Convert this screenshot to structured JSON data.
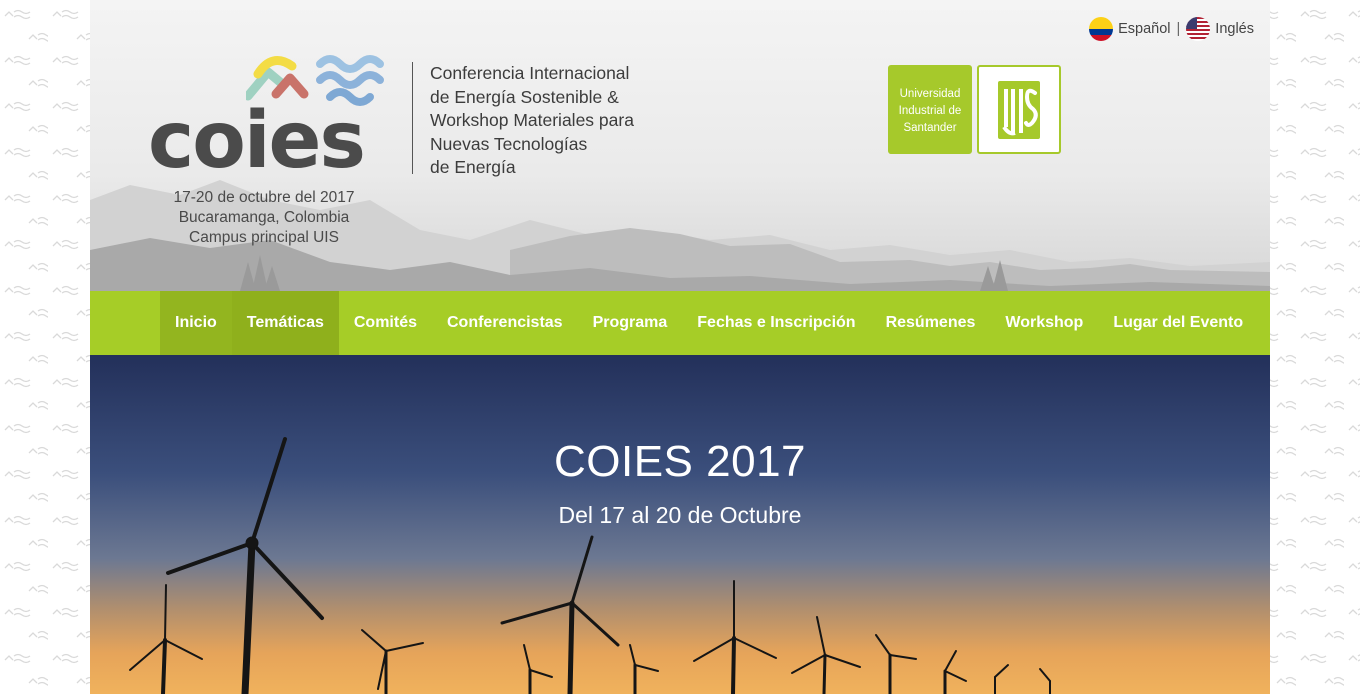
{
  "header": {
    "logo_text": "coies",
    "logo_lines": [
      "17-20 de octubre del 2017",
      "Bucaramanga, Colombia",
      "Campus principal UIS"
    ],
    "conference_lines": [
      "Conferencia Internacional",
      "de Energía Sostenible &",
      "Workshop Materiales para",
      "Nuevas Tecnologías",
      "de Energía"
    ],
    "university_lines": [
      "Universidad",
      "Industrial de",
      "Santander"
    ],
    "university_logo_text": "UIS"
  },
  "language": {
    "spanish_label": "Español",
    "separator": "|",
    "english_label": "Inglés"
  },
  "nav": {
    "items": [
      {
        "label": "Inicio"
      },
      {
        "label": "Temáticas"
      },
      {
        "label": "Comités"
      },
      {
        "label": "Conferencistas"
      },
      {
        "label": "Programa"
      },
      {
        "label": "Fechas e Inscripción"
      },
      {
        "label": "Resúmenes"
      },
      {
        "label": "Workshop"
      },
      {
        "label": "Lugar del Evento"
      }
    ]
  },
  "hero": {
    "title": "COIES 2017",
    "subtitle": "Del 17 al 20 de Octubre"
  },
  "colors": {
    "brand_green": "#a6cd27",
    "nav_active": "#93b51f",
    "text_dark": "#3c3c3c"
  }
}
